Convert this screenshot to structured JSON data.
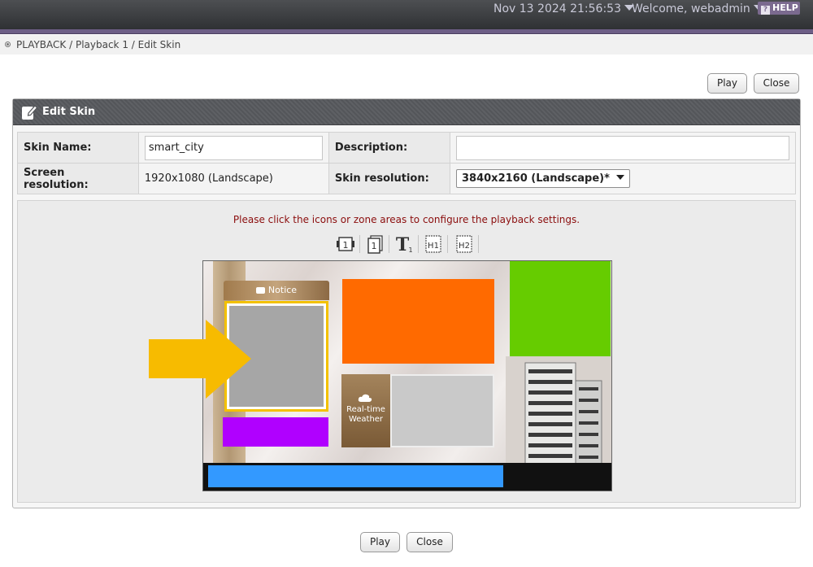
{
  "topbar": {
    "datetime": "Nov 13 2024 21:56:53",
    "welcome": "Welcome, webadmin",
    "help": "HELP",
    "help_glyph": "?"
  },
  "breadcrumb": "PLAYBACK / Playback 1 / Edit Skin",
  "buttons": {
    "play": "Play",
    "close": "Close"
  },
  "panel": {
    "title": "Edit Skin",
    "skin_name_label": "Skin Name:",
    "skin_name_value": "smart_city",
    "description_label": "Description:",
    "description_value": "",
    "screen_res_label": "Screen resolution:",
    "screen_res_value": "1920x1080 (Landscape)",
    "skin_res_label": "Skin resolution:",
    "skin_res_value": "3840x2160 (Landscape)*"
  },
  "editor": {
    "hint": "Please click the icons or zone areas to configure the playback settings.",
    "tools": [
      "video-zone-icon",
      "image-zone-icon",
      "text-zone-icon",
      "h1-zone-icon",
      "h2-zone-icon"
    ],
    "notice_label": "Notice",
    "weather_label_1": "Real-time",
    "weather_label_2": "Weather"
  },
  "colors": {
    "orange_zone": "#ff6a00",
    "green_zone": "#66cc00",
    "purple_zone": "#b000ff",
    "ticker_zone": "#3399ff",
    "selected_border": "#f3c100",
    "arrow": "#f7bb00"
  }
}
